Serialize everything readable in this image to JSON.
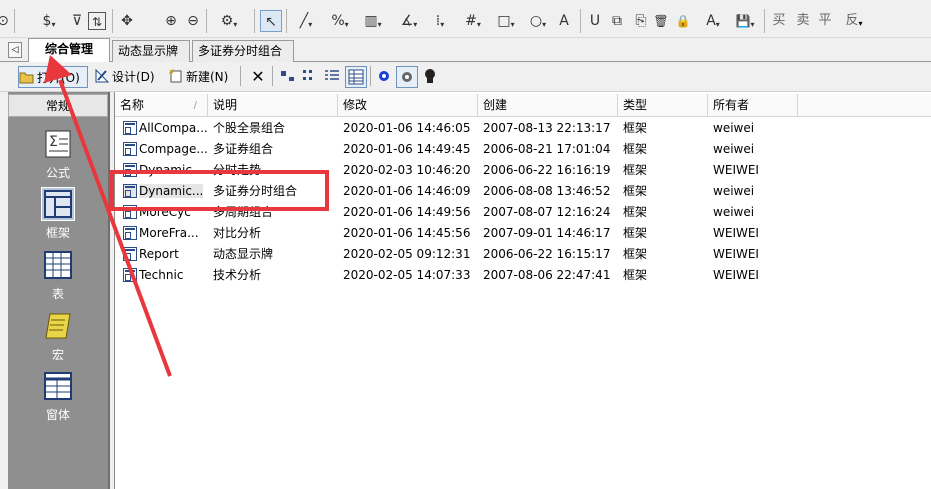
{
  "draw_toolbar": {
    "items": [
      {
        "glyph": "⊙"
      },
      {
        "glyph": "$"
      },
      {
        "glyph": "⊽"
      },
      {
        "glyph": "⇅"
      },
      {
        "glyph": "✥"
      },
      {
        "glyph": "⊕"
      },
      {
        "glyph": "⊖"
      },
      {
        "glyph": "⚙"
      },
      {
        "glyph": "↖"
      },
      {
        "glyph": "╱"
      },
      {
        "glyph": "%"
      },
      {
        "glyph": "▥"
      },
      {
        "glyph": "∡"
      },
      {
        "glyph": "⁞"
      },
      {
        "glyph": "#"
      },
      {
        "glyph": "□"
      },
      {
        "glyph": "○"
      },
      {
        "glyph": "A"
      },
      {
        "glyph": "U"
      },
      {
        "glyph": "⧉"
      },
      {
        "glyph": "🗑"
      },
      {
        "glyph": "🔒"
      },
      {
        "glyph": "A"
      },
      {
        "glyph": "💾"
      }
    ],
    "text_buttons": [
      "买",
      "卖",
      "平",
      "反"
    ]
  },
  "tabs": {
    "back_glyph": "◁",
    "items": [
      {
        "label": "综合管理",
        "active": true
      },
      {
        "label": "动态显示牌",
        "active": false
      },
      {
        "label": "多证券分时组合",
        "active": false
      }
    ]
  },
  "command_toolbar": {
    "open_label": "打开(O)",
    "design_label": "设计(D)",
    "new_label": "新建(N)",
    "delete_glyph": "✕"
  },
  "left_panel": {
    "header": "常规",
    "items": [
      {
        "label": "公式",
        "icon": "formula-icon",
        "selected": false
      },
      {
        "label": "框架",
        "icon": "frame-icon",
        "selected": true
      },
      {
        "label": "表",
        "icon": "table-icon",
        "selected": false
      },
      {
        "label": "宏",
        "icon": "macro-scroll-icon",
        "selected": false
      },
      {
        "label": "窗体",
        "icon": "form-icon",
        "selected": false
      }
    ]
  },
  "list": {
    "columns": [
      "名称",
      "说明",
      "修改",
      "创建",
      "类型",
      "所有者"
    ],
    "sort_indicator": "/",
    "rows": [
      {
        "name": "AllCompa...",
        "desc": "个股全景组合",
        "modified": "2020-01-06 14:46:05",
        "created": "2007-08-13 22:13:17",
        "type": "框架",
        "owner": "weiwei"
      },
      {
        "name": "Compage...",
        "desc": "多证券组合",
        "modified": "2020-01-06 14:49:45",
        "created": "2006-08-21 17:01:04",
        "type": "框架",
        "owner": "weiwei"
      },
      {
        "name": "Dynamic",
        "desc": "分时走势",
        "modified": "2020-02-03 10:46:20",
        "created": "2006-06-22 16:16:19",
        "type": "框架",
        "owner": "WEIWEI"
      },
      {
        "name": "Dynamic...",
        "desc": "多证券分时组合",
        "modified": "2020-01-06 14:46:09",
        "created": "2006-08-08 13:46:52",
        "type": "框架",
        "owner": "weiwei",
        "selected": true
      },
      {
        "name": "MoreCyc",
        "desc": "多周期组合",
        "modified": "2020-01-06 14:49:56",
        "created": "2007-08-07 12:16:24",
        "type": "框架",
        "owner": "weiwei"
      },
      {
        "name": "MoreFra...",
        "desc": "对比分析",
        "modified": "2020-01-06 14:45:56",
        "created": "2007-09-01 14:46:17",
        "type": "框架",
        "owner": "WEIWEI"
      },
      {
        "name": "Report",
        "desc": "动态显示牌",
        "modified": "2020-02-05 09:12:31",
        "created": "2006-06-22 16:15:17",
        "type": "框架",
        "owner": "WEIWEI"
      },
      {
        "name": "Technic",
        "desc": "技术分析",
        "modified": "2020-02-05 14:07:33",
        "created": "2007-08-06 22:47:41",
        "type": "框架",
        "owner": "WEIWEI"
      }
    ]
  },
  "annotation": {
    "color": "#e8383d"
  }
}
